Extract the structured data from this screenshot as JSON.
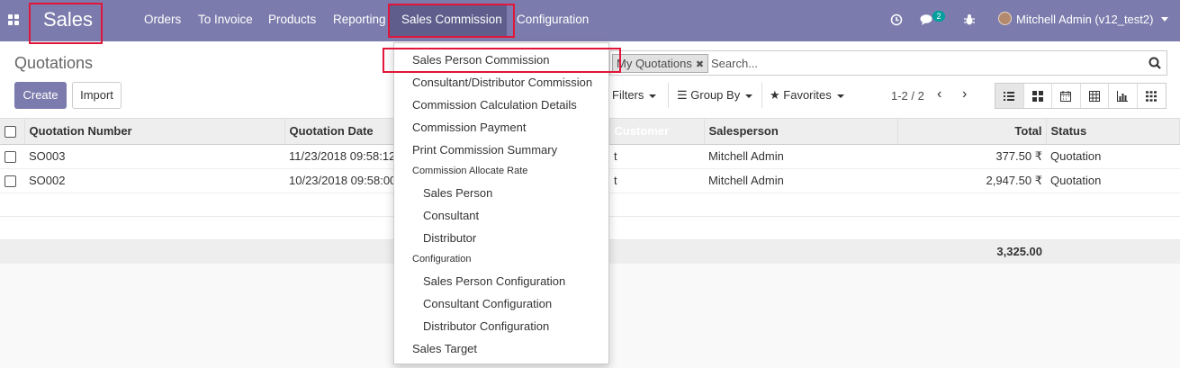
{
  "app": {
    "name": "Sales"
  },
  "nav": {
    "menus": [
      "Orders",
      "To Invoice",
      "Products",
      "Reporting",
      "Sales Commission",
      "Configuration"
    ],
    "active_menu": "Sales Commission",
    "message_count": "2",
    "user": "Mitchell Admin (v12_test2)"
  },
  "page": {
    "title": "Quotations"
  },
  "buttons": {
    "create": "Create",
    "import": "Import"
  },
  "search": {
    "facet": "My Quotations",
    "placeholder": "Search...",
    "filters": "Filters",
    "group_by": "Group By",
    "favorites": "Favorites"
  },
  "pager": {
    "value": "1-2 / 2"
  },
  "table": {
    "columns": [
      "Quotation Number",
      "Quotation Date",
      "Customer",
      "Salesperson",
      "Total",
      "Status"
    ],
    "rows": [
      {
        "number": "SO003",
        "date": "11/23/2018 09:58:12",
        "customer": "t",
        "salesperson": "Mitchell Admin",
        "total": "377.50 ₹",
        "status": "Quotation"
      },
      {
        "number": "SO002",
        "date": "10/23/2018 09:58:00",
        "customer": "t",
        "salesperson": "Mitchell Admin",
        "total": "2,947.50 ₹",
        "status": "Quotation"
      }
    ],
    "sum_total": "3,325.00"
  },
  "dropdown": {
    "items": [
      {
        "label": "Sales Person Commission",
        "type": "item"
      },
      {
        "label": "Consultant/Distributor Commission",
        "type": "item"
      },
      {
        "label": "Commission Calculation Details",
        "type": "item"
      },
      {
        "label": "Commission Payment",
        "type": "item"
      },
      {
        "label": "Print Commission Summary",
        "type": "item"
      },
      {
        "label": "Commission Allocate Rate",
        "type": "header"
      },
      {
        "label": "Sales Person",
        "type": "sub"
      },
      {
        "label": "Consultant",
        "type": "sub"
      },
      {
        "label": "Distributor",
        "type": "sub"
      },
      {
        "label": "Configuration",
        "type": "header"
      },
      {
        "label": "Sales Person Configuration",
        "type": "sub"
      },
      {
        "label": "Consultant Configuration",
        "type": "sub"
      },
      {
        "label": "Distributor Configuration",
        "type": "sub"
      },
      {
        "label": "Sales Target",
        "type": "item"
      }
    ]
  },
  "colors": {
    "brand": "#7c7bad",
    "highlight": "#e0163a",
    "badge": "#00a09d"
  }
}
